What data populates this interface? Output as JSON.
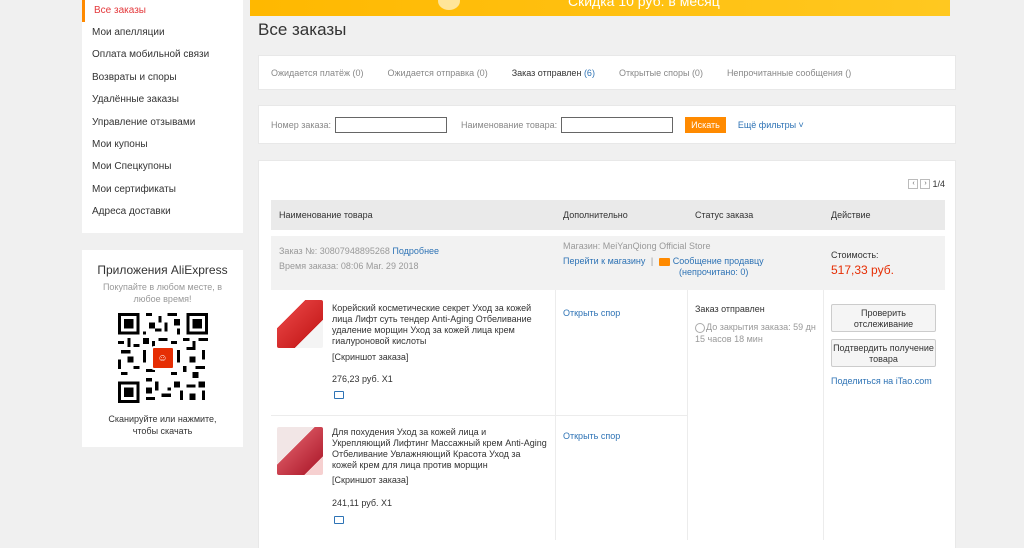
{
  "sidebar": {
    "items": [
      {
        "label": "Все заказы"
      },
      {
        "label": "Мои апелляции"
      },
      {
        "label": "Оплата мобильной связи"
      },
      {
        "label": "Возвраты и споры"
      },
      {
        "label": "Удалённые заказы"
      },
      {
        "label": "Управление отзывами"
      },
      {
        "label": "Мои купоны"
      },
      {
        "label": "Мои Спецкупоны"
      },
      {
        "label": "Мои сертификаты"
      },
      {
        "label": "Адреса доставки"
      }
    ]
  },
  "app_box": {
    "title": "Приложения AliExpress",
    "subtitle": "Покупайте в любом месте, в любое время!",
    "qr_logo_text": "☺",
    "scan_text": "Сканируйте или нажмите, чтобы скачать"
  },
  "banner": {
    "text": "Скидка 10 руб. в месяц"
  },
  "page": {
    "title": "Все заказы"
  },
  "status_tabs": [
    {
      "label": "Ожидается платёж",
      "count": "(0)"
    },
    {
      "label": "Ожидается отправка",
      "count": "(0)"
    },
    {
      "label": "Заказ отправлен",
      "count": "(6)"
    },
    {
      "label": "Открытые споры",
      "count": "(0)"
    },
    {
      "label": "Непрочитанные сообщения",
      "count": "()"
    }
  ],
  "filter": {
    "order_number_label": "Номер заказа:",
    "product_name_label": "Наименование товара:",
    "search_label": "Искать",
    "more_filters_label": "Ещё фильтры ˅"
  },
  "pager": {
    "text": "1/4",
    "prev": "‹",
    "next": "›"
  },
  "table_headers": {
    "product": "Наименование товара",
    "extra": "Дополнительно",
    "status": "Статус заказа",
    "action": "Действие"
  },
  "order": {
    "number_label": "Заказ №:",
    "number": "30807948895268",
    "details_link": "Подробнее",
    "time_label": "Время заказа:",
    "time": "08:06 Mar. 29 2018",
    "store_label": "Магазин:",
    "store": "MeiYanQiong Official Store",
    "goto_store": "Перейти к магазину",
    "separator": "|",
    "message_seller": "Сообщение продавцу",
    "unread": "(непрочитано: 0)",
    "cost_label": "Стоимость:",
    "cost": "517,33 руб.",
    "status": "Заказ отправлен",
    "closing_time": "До закрытия заказа: 59 дн 15 часов 18 мин",
    "track_label": "Проверить отслеживание",
    "confirm_label": "Подтвердить получение товара",
    "share_text": "Поделиться на ",
    "share_site": "iTao.com"
  },
  "items": [
    {
      "title": "Корейский косметические секрет Уход за кожей лица Лифт суть тендер Anti-Aging Отбеливание удаление морщин Уход за кожей лица крем гиалуроновой кислоты",
      "screenshot": "[Скриншот заказа]",
      "price": "276,23 руб. X1",
      "dispute": "Открыть спор"
    },
    {
      "title": "Для похудения Уход за кожей лица и Укрепляющий Лифтинг Массажный крем Anti-Aging Отбеливание Увлажняющий Красота Уход за кожей крем для лица против морщин",
      "screenshot": "[Скриншот заказа]",
      "price": "241,11 руб. X1",
      "dispute": "Открыть спор"
    }
  ],
  "colors": {
    "accent": "#ff8a00",
    "link": "#2e73b5",
    "price": "#e62e04"
  }
}
